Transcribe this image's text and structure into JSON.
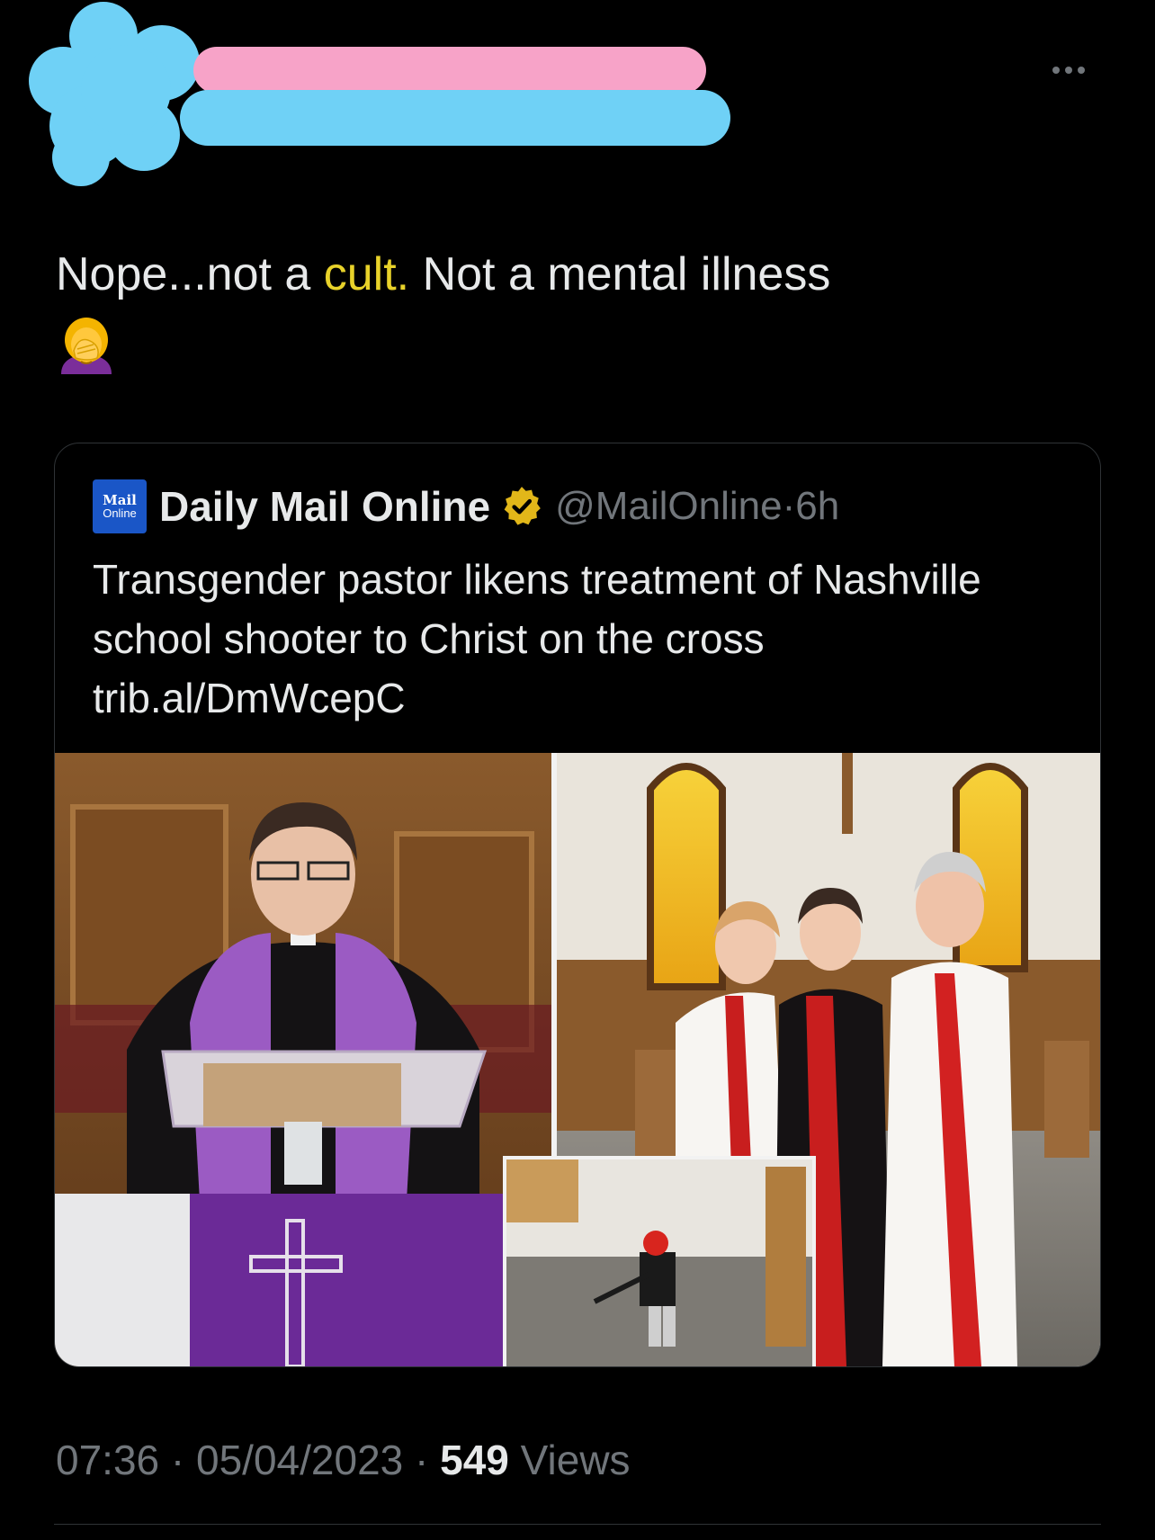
{
  "tweet": {
    "author_redacted": true,
    "text_part1": "Nope...not a ",
    "text_highlight": "cult.",
    "text_part2": " Not a mental illness",
    "emoji_icon": "woman-facepalming-emoji",
    "colors": {
      "highlight": "#e8d22a",
      "redaction_pink": "#f7a3c8",
      "redaction_blue": "#6fd1f6"
    }
  },
  "quote": {
    "logo_line1": "Mail",
    "logo_line2": "Online",
    "name": "Daily Mail Online",
    "verified_icon": "gold-verified-badge",
    "handle": "@MailOnline",
    "separator": "·",
    "time": "6h",
    "text": "Transgender pastor likens treatment of Nashville school shooter to Christ on the cross trib.al/DmWcepC",
    "media": {
      "left_photo": "pastor in clerical collar and purple stole speaking at a lectern with purple cross cloth",
      "right_photo": "three clergy in white robes and red stoles posing in a church with stained glass windows",
      "inset_photo": "security camera still of an armed person in a school hallway"
    }
  },
  "footer": {
    "time": "07:36",
    "sep": " · ",
    "date": "05/04/2023",
    "views_count": "549",
    "views_label": " Views"
  }
}
